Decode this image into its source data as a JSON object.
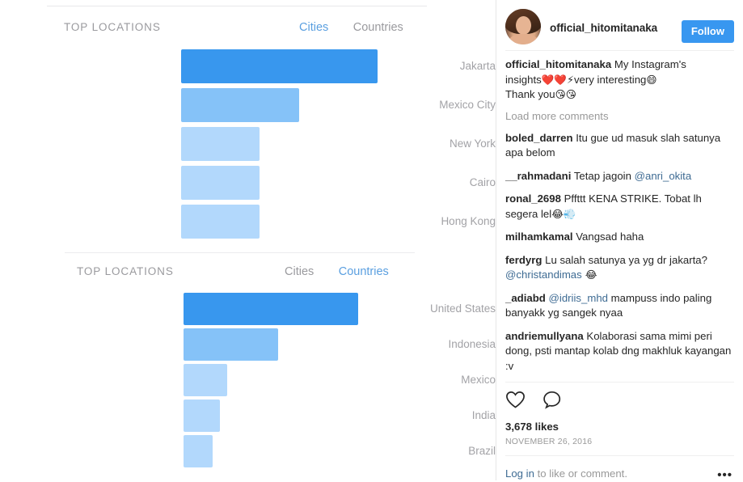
{
  "insights": {
    "cities_card": {
      "title": "TOP LOCATIONS",
      "tabs": [
        {
          "label": "Cities",
          "active": true
        },
        {
          "label": "Countries",
          "active": false
        }
      ]
    },
    "countries_card": {
      "title": "TOP LOCATIONS",
      "tabs": [
        {
          "label": "Cities",
          "active": false
        },
        {
          "label": "Countries",
          "active": true
        }
      ]
    },
    "colors": {
      "bar_primary": "#3897ee",
      "bar_secondary": "#85c2f8",
      "bar_tertiary": "#b2d8fc",
      "tab_active": "#5a9fe0",
      "tab_inactive": "#9a9a9e",
      "label": "#a2a2a6"
    }
  },
  "chart_data": [
    {
      "type": "bar",
      "title": "TOP LOCATIONS",
      "orientation": "horizontal",
      "subtitle": "Cities",
      "categories": [
        "Jakarta",
        "Mexico City",
        "New York",
        "Cairo",
        "Hong Kong"
      ],
      "values": [
        100,
        60,
        40,
        40,
        40
      ],
      "bar_colors": [
        "#3897ee",
        "#85c2f8",
        "#b2d8fc",
        "#b2d8fc",
        "#b2d8fc"
      ],
      "xlabel": "",
      "ylabel": "",
      "grid": false,
      "legend": "none",
      "xlim": [
        0,
        100
      ]
    },
    {
      "type": "bar",
      "title": "TOP LOCATIONS",
      "orientation": "horizontal",
      "subtitle": "Countries",
      "categories": [
        "United States",
        "Indonesia",
        "Mexico",
        "India",
        "Brazil"
      ],
      "values": [
        100,
        54,
        25,
        21,
        17
      ],
      "bar_colors": [
        "#3897ee",
        "#85c2f8",
        "#b2d8fc",
        "#b2d8fc",
        "#b2d8fc"
      ],
      "xlabel": "",
      "ylabel": "",
      "grid": false,
      "legend": "none",
      "xlim": [
        0,
        100
      ]
    }
  ],
  "instagram": {
    "username": "official_hitomitanaka",
    "follow_label": "Follow",
    "caption": {
      "user": "official_hitomitanaka",
      "line1": "My Instagram's",
      "line2_pre": "insights",
      "emoji1": "❤️❤️⚡",
      "line2_post": "very interesting",
      "emoji2": "😄",
      "line3": "Thank you",
      "emoji3": "😘😘"
    },
    "load_more": "Load more comments",
    "comments": [
      {
        "user": "boled_darren",
        "text": "Itu gue ud masuk slah satunya apa belom"
      },
      {
        "user": "__rahmadani",
        "text": "Tetap jagoin ",
        "mention": "@anri_okita"
      },
      {
        "user": "ronal_2698",
        "text": "Pffttt KENA STRIKE. Tobat lh segera lel",
        "emoji": "😂💨"
      },
      {
        "user": "milhamkamal",
        "text": "Vangsad haha"
      },
      {
        "user": "ferdyrg",
        "text": "Lu salah satunya ya yg dr jakarta? ",
        "mention": "@christandimas",
        "emoji": " 😂"
      },
      {
        "user": "_adiabd",
        "mention": "@idriis_mhd",
        "text": " mampuss indo paling banyakk yg sangek nyaa"
      },
      {
        "user": "andriemullyana",
        "text": "Kolaborasi sama mimi peri dong, psti mantap kolab dng makhluk kayangan :v"
      }
    ],
    "likes": "3,678 likes",
    "date": "NOVEMBER 26, 2016",
    "footer": {
      "login": "Log in",
      "rest": " to like or comment.",
      "more": "•••"
    },
    "colors": {
      "brand_blue": "#3897f0",
      "link": "#3e6b93",
      "muted": "#999999"
    }
  }
}
